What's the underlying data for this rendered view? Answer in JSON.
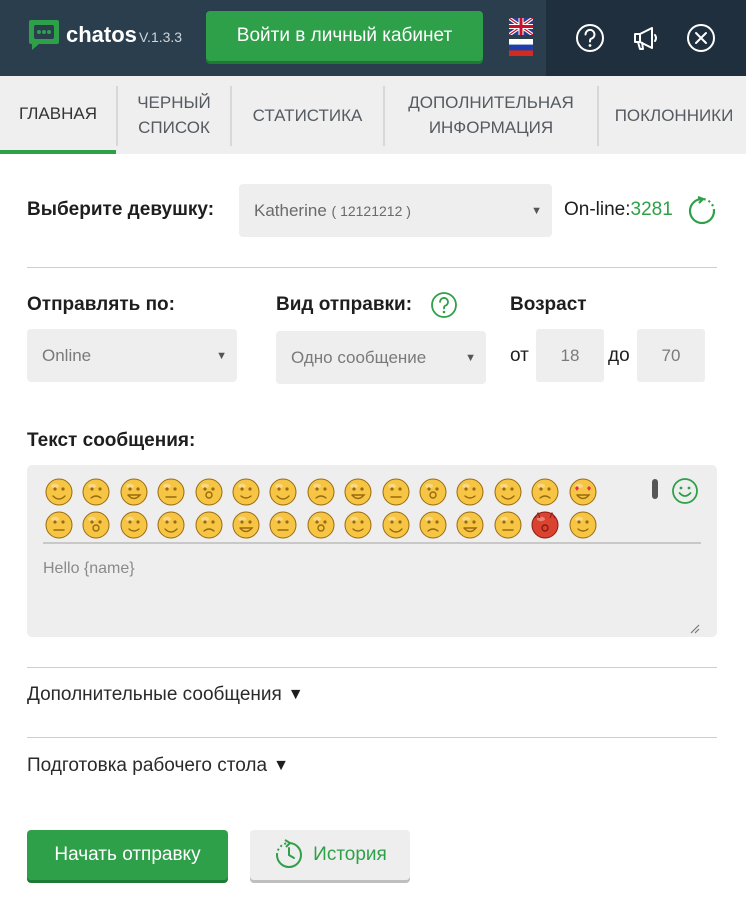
{
  "header": {
    "brand": "chatos",
    "version": "V.1.3.3",
    "login_button": "Войти в личный кабинет",
    "languages": [
      "en-flag-icon",
      "ru-flag-icon"
    ],
    "icons": [
      "help-icon",
      "megaphone-icon",
      "close-icon"
    ]
  },
  "tabs": [
    {
      "label": "ГЛАВНАЯ",
      "active": true
    },
    {
      "label": "ЧЕРНЫЙ СПИСОК",
      "active": false
    },
    {
      "label": "СТАТИСТИКА",
      "active": false
    },
    {
      "label": "ДОПОЛНИТЕЛЬНАЯ ИНФОРМАЦИЯ",
      "active": false
    },
    {
      "label": "ПОКЛОННИКИ",
      "active": false
    }
  ],
  "girl": {
    "label": "Выберите девушку:",
    "name": "Katherine",
    "id_text": "( 12121212 )",
    "online_label": "On-line:",
    "online_count": "3281"
  },
  "send": {
    "send_by_label": "Отправлять по:",
    "send_by_value": "Online",
    "send_type_label": "Вид отправки:",
    "send_type_value": "Одно сообщение",
    "age_label": "Возраст",
    "age_from_word": "от",
    "age_from": "18",
    "age_to_word": "до",
    "age_to": "70"
  },
  "message": {
    "label": "Текст сообщения:",
    "text": "Hello {name}",
    "emoji_count": 30
  },
  "sections": {
    "extra_messages": "Дополнительные сообщения",
    "desktop_prep": "Подготовка рабочего стола"
  },
  "actions": {
    "start": "Начать отправку",
    "history": "История"
  },
  "colors": {
    "accent": "#2fa04a",
    "header_bg": "#2a3e4e",
    "tab_bg": "#efefef",
    "field_bg": "#eeeeee"
  }
}
